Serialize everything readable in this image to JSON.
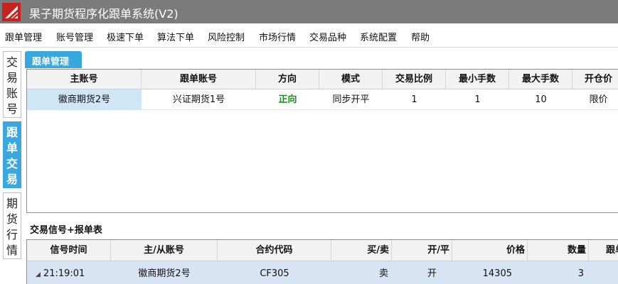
{
  "window": {
    "title": "果子期货程序化跟单系统(V2)",
    "brand_color": "#c9221e",
    "accent_color": "#3aa8df"
  },
  "menu": [
    "跟单管理",
    "账号管理",
    "极速下单",
    "算法下单",
    "风险控制",
    "市场行情",
    "交易品种",
    "系统配置",
    "帮助"
  ],
  "sidebar": {
    "tabs": [
      {
        "label": [
          "交",
          "易",
          "账",
          "号"
        ],
        "active": false
      },
      {
        "label": [
          "跟",
          "单",
          "交",
          "易"
        ],
        "active": true
      },
      {
        "label": [
          "期",
          "货",
          "行",
          "情"
        ],
        "active": false
      }
    ]
  },
  "follow_section": {
    "tab_label": "跟单管理",
    "columns": [
      "主账号",
      "跟单账号",
      "方向",
      "模式",
      "交易比例",
      "最小手数",
      "最大手数",
      "开仓价"
    ],
    "rows": [
      [
        "徽商期货2号",
        "兴证期货1号",
        "正向",
        "同步开平",
        "1",
        "1",
        "10",
        "限价"
      ]
    ]
  },
  "signal_section": {
    "label": "交易信号+报单表",
    "columns": [
      "信号时间",
      "主/从账号",
      "合约代码",
      "买/卖",
      "开/平",
      "价格",
      "数量",
      "跟单"
    ],
    "rows": [
      [
        "21:19:01",
        "徽商期货2号",
        "CF305",
        "卖",
        "开",
        "14305",
        "3",
        ""
      ]
    ],
    "expander_icon": "triangle-expand-icon"
  }
}
